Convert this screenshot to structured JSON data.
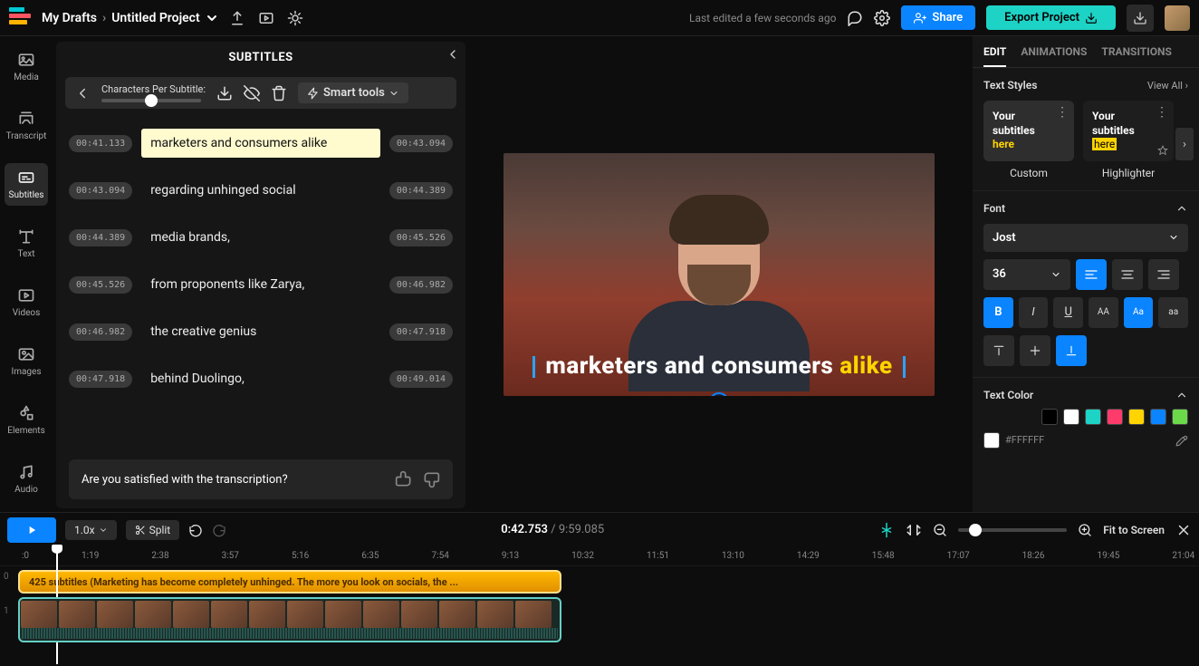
{
  "breadcrumb": {
    "drafts": "My Drafts",
    "project": "Untitled Project"
  },
  "last_edited": "Last edited a few seconds ago",
  "buttons": {
    "share": "Share",
    "export": "Export Project"
  },
  "left_nav": {
    "media": "Media",
    "transcript": "Transcript",
    "subtitles": "Subtitles",
    "text": "Text",
    "videos": "Videos",
    "images": "Images",
    "elements": "Elements",
    "audio": "Audio"
  },
  "panel": {
    "title": "SUBTITLES",
    "cps_label": "Characters Per Subtitle:",
    "smart_tools": "Smart tools",
    "feedback_q": "Are you satisfied with the transcription?"
  },
  "subtitles": [
    {
      "start": "00:41.133",
      "text": "marketers and consumers alike",
      "end": "00:43.094",
      "hl": true
    },
    {
      "start": "00:43.094",
      "text": "regarding unhinged social",
      "end": "00:44.389"
    },
    {
      "start": "00:44.389",
      "text": "media brands,",
      "end": "00:45.526"
    },
    {
      "start": "00:45.526",
      "text": "from proponents like Zarya,",
      "end": "00:46.982"
    },
    {
      "start": "00:46.982",
      "text": "the creative genius",
      "end": "00:47.918"
    },
    {
      "start": "00:47.918",
      "text": "behind Duolingo,",
      "end": "00:49.014"
    }
  ],
  "overlay": {
    "pre": "marketers and consumers ",
    "hl": "alike"
  },
  "right": {
    "tabs": {
      "edit": "EDIT",
      "anim": "ANIMATIONS",
      "trans": "TRANSITIONS"
    },
    "text_styles": {
      "head": "Text Styles",
      "view_all": "View All ›",
      "card_line1": "Your",
      "card_line2": "subtitles",
      "card_here": "here",
      "label1": "Custom",
      "label2": "Highlighter"
    },
    "font": {
      "head": "Font",
      "family": "Jost",
      "size": "36"
    },
    "color": {
      "head": "Text Color",
      "hex": "#FFFFFF"
    }
  },
  "swatches": [
    "#000000",
    "#ffffff",
    "#1dd3c5",
    "#ff3b6b",
    "#ffd400",
    "#0a84ff",
    "#6bd94a"
  ],
  "timeline": {
    "speed": "1.0x",
    "split": "Split",
    "current": "0:42.753",
    "duration": "9:59.085",
    "fit": "Fit to Screen",
    "marks": [
      ":0",
      "1:19",
      "2:38",
      "3:57",
      "5:16",
      "6:35",
      "7:54",
      "9:13",
      "10:32",
      "11:51",
      "13:10",
      "14:29",
      "15:48",
      "17:07",
      "18:26",
      "19:45",
      "21:04"
    ],
    "clip_label": "425 subtitles (Marketing has become completely unhinged. The more you look on socials, the ..."
  }
}
